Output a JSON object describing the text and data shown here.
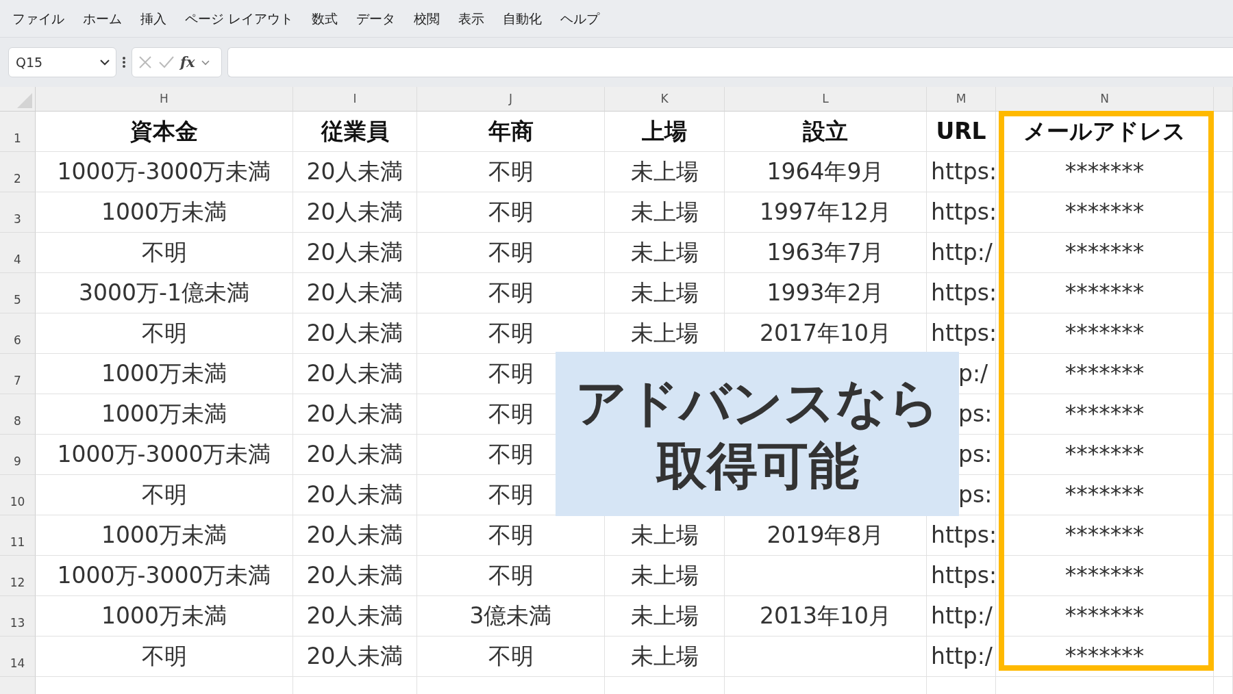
{
  "menu": [
    "ファイル",
    "ホーム",
    "挿入",
    "ページ レイアウト",
    "数式",
    "データ",
    "校閲",
    "表示",
    "自動化",
    "ヘルプ"
  ],
  "name_box": {
    "value": "Q15"
  },
  "formula_bar": {
    "function_label": "fx"
  },
  "columns": [
    {
      "label": "H",
      "highlighted": false
    },
    {
      "label": "I",
      "highlighted": false
    },
    {
      "label": "J",
      "highlighted": false
    },
    {
      "label": "K",
      "highlighted": false
    },
    {
      "label": "L",
      "highlighted": false
    },
    {
      "label": "M",
      "highlighted": false
    },
    {
      "label": "N",
      "highlighted": true
    }
  ],
  "rows": [
    {
      "number": "1",
      "kind": "header",
      "covered": false,
      "cells": [
        "資本金",
        "従業員",
        "年商",
        "上場",
        "設立",
        "URL",
        "メールアドレス"
      ]
    },
    {
      "number": "2",
      "kind": "data",
      "covered": false,
      "cells": [
        "1000万-3000万未満",
        "20人未満",
        "不明",
        "未上場",
        "1964年9月",
        "https:",
        "*******"
      ]
    },
    {
      "number": "3",
      "kind": "data",
      "covered": false,
      "cells": [
        "1000万未満",
        "20人未満",
        "不明",
        "未上場",
        "1997年12月",
        "https:",
        "*******"
      ]
    },
    {
      "number": "4",
      "kind": "data",
      "covered": false,
      "cells": [
        "不明",
        "20人未満",
        "不明",
        "未上場",
        "1963年7月",
        "http:/",
        "*******"
      ]
    },
    {
      "number": "5",
      "kind": "data",
      "covered": false,
      "cells": [
        "3000万-1億未満",
        "20人未満",
        "不明",
        "未上場",
        "1993年2月",
        "https:",
        "*******"
      ]
    },
    {
      "number": "6",
      "kind": "data",
      "covered": false,
      "cells": [
        "不明",
        "20人未満",
        "不明",
        "未上場",
        "2017年10月",
        "https:",
        "*******"
      ]
    },
    {
      "number": "7",
      "kind": "data",
      "covered": true,
      "cells": [
        "1000万未満",
        "20人未満",
        "不明",
        null,
        null,
        "p:/",
        "*******"
      ]
    },
    {
      "number": "8",
      "kind": "data",
      "covered": true,
      "cells": [
        "1000万未満",
        "20人未満",
        "不明",
        null,
        null,
        "ps:",
        "*******"
      ]
    },
    {
      "number": "9",
      "kind": "data",
      "covered": true,
      "cells": [
        "1000万-3000万未満",
        "20人未満",
        "不明",
        null,
        null,
        "ps:",
        "*******"
      ]
    },
    {
      "number": "10",
      "kind": "data",
      "covered": true,
      "cells": [
        "不明",
        "20人未満",
        "不明",
        null,
        null,
        "ps:",
        "*******"
      ]
    },
    {
      "number": "11",
      "kind": "data",
      "covered": false,
      "cells": [
        "1000万未満",
        "20人未満",
        "不明",
        "未上場",
        "2019年8月",
        "https:",
        "*******"
      ]
    },
    {
      "number": "12",
      "kind": "data",
      "covered": false,
      "cells": [
        "1000万-3000万未満",
        "20人未満",
        "不明",
        "未上場",
        null,
        "https:",
        "*******"
      ]
    },
    {
      "number": "13",
      "kind": "data",
      "covered": false,
      "cells": [
        "1000万未満",
        "20人未満",
        "3億未満",
        "未上場",
        "2013年10月",
        "http:/",
        "*******"
      ]
    },
    {
      "number": "14",
      "kind": "data",
      "covered": false,
      "cells": [
        "不明",
        "20人未満",
        "不明",
        "未上場",
        null,
        "http:/",
        "*******"
      ]
    }
  ],
  "callout": {
    "lines": [
      "アドバンスなら",
      "取得可能"
    ]
  }
}
